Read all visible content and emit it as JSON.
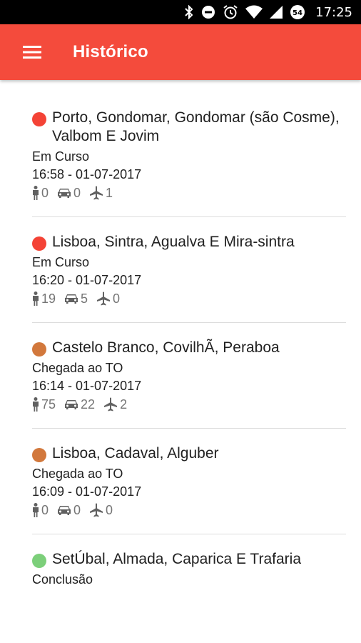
{
  "status_bar": {
    "icons": [
      "bluetooth-icon",
      "do-not-disturb-icon",
      "alarm-icon",
      "wifi-icon",
      "signal-icon",
      "battery-icon"
    ],
    "battery": "54",
    "time": "17:25"
  },
  "app_bar": {
    "menu_icon": "menu-icon",
    "title": "Histórico",
    "color": "#f44b3c"
  },
  "items": [
    {
      "title": "Porto, Gondomar, Gondomar (são Cosme), Valbom E Jovim",
      "status": "Em Curso",
      "status_color": "#f44336",
      "time": "16:58 - 01-07-2017",
      "people": "0",
      "vehicles": "0",
      "aircraft": "1"
    },
    {
      "title": "Lisboa, Sintra, Agualva E Mira-sintra",
      "status": "Em Curso",
      "status_color": "#f44336",
      "time": "16:20 - 01-07-2017",
      "people": "19",
      "vehicles": "5",
      "aircraft": "0"
    },
    {
      "title": "Castelo Branco, CovilhÃ, Peraboa",
      "status": "Chegada ao TO",
      "status_color": "#d2783c",
      "time": "16:14 - 01-07-2017",
      "people": "75",
      "vehicles": "22",
      "aircraft": "2"
    },
    {
      "title": "Lisboa, Cadaval, Alguber",
      "status": "Chegada ao TO",
      "status_color": "#d2783c",
      "time": "16:09 - 01-07-2017",
      "people": "0",
      "vehicles": "0",
      "aircraft": "0"
    },
    {
      "title": "SetÚbal, Almada, Caparica E Trafaria",
      "status": "Conclusão",
      "status_color": "#7ccf7a",
      "time": "",
      "people": "",
      "vehicles": "",
      "aircraft": ""
    }
  ]
}
